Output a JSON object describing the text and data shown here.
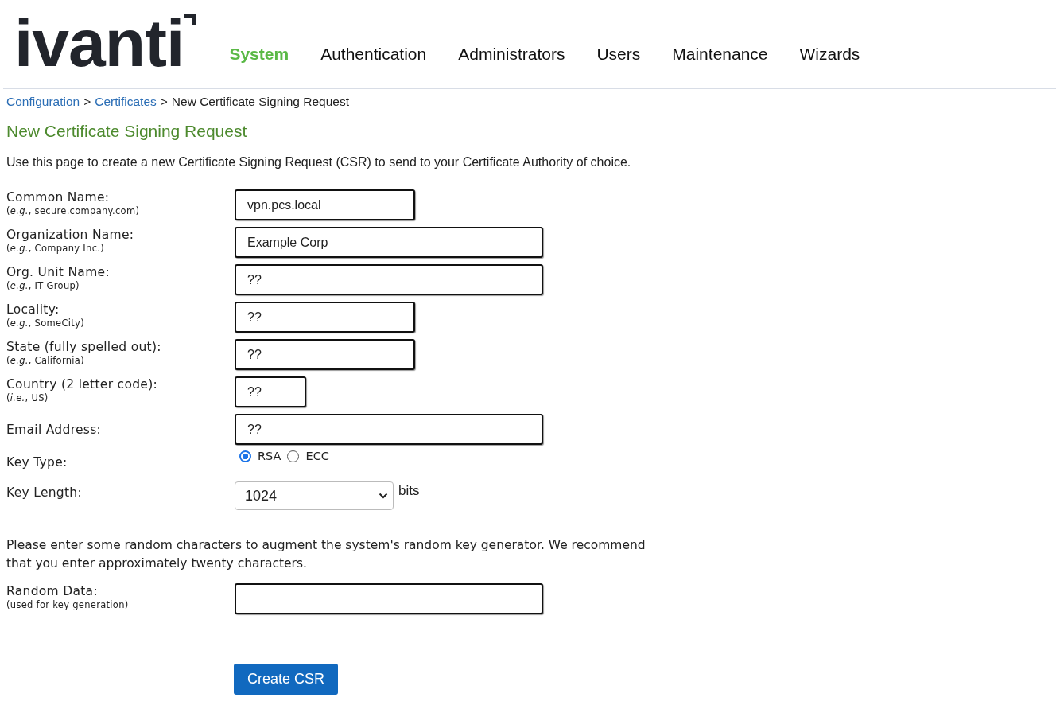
{
  "logo": {
    "text": "ivanti"
  },
  "nav": [
    {
      "label": "System",
      "selected": true
    },
    {
      "label": "Authentication",
      "selected": false
    },
    {
      "label": "Administrators",
      "selected": false
    },
    {
      "label": "Users",
      "selected": false
    },
    {
      "label": "Maintenance",
      "selected": false
    },
    {
      "label": "Wizards",
      "selected": false
    }
  ],
  "breadcrumb": [
    {
      "label": "Configuration",
      "kind": "link"
    },
    {
      "label": ">",
      "kind": "separator"
    },
    {
      "label": "Certificates",
      "kind": "link"
    },
    {
      "label": ">",
      "kind": "separator"
    },
    {
      "label": "New Certificate Signing Request",
      "kind": "current"
    }
  ],
  "page_title": "New Certificate Signing Request",
  "description": "Use this page to create a new Certificate Signing Request (CSR) to send to your Certificate Authority of choice.",
  "fields": [
    {
      "kind": "text",
      "label": "Common Name:",
      "hint": "(*e.g.*, secure.company.com)",
      "value": "vpn.pcs.local"
    },
    {
      "kind": "text",
      "label": "Organization Name:",
      "hint": "(*e.g.*, Company Inc.)",
      "value": "Example Corp"
    },
    {
      "kind": "text",
      "label": "Org. Unit Name:",
      "hint": "(*e.g.*, IT Group)",
      "value": "??"
    },
    {
      "kind": "text",
      "label": "Locality:",
      "hint": "(*e.g.*, SomeCity)",
      "value": "??"
    },
    {
      "kind": "text",
      "label": "State (fully spelled out):",
      "hint": "(*e.g.*, California)",
      "value": "??"
    },
    {
      "kind": "text",
      "label": "Country (2 letter code):",
      "hint": "(*i.e.*, US)",
      "value": "??"
    },
    {
      "kind": "text",
      "label": "Email Address:",
      "value": "??"
    },
    {
      "kind": "radio",
      "label": "Key Type:",
      "options": [
        {
          "label": "RSA",
          "selected": true
        },
        {
          "label": "ECC",
          "selected": false
        }
      ]
    },
    {
      "kind": "select",
      "label": "Key Length:",
      "value": "1024",
      "unit": "bits"
    }
  ],
  "random_note": "Please enter some random characters to augment the system's random key generator. We recommend that you enter approximately twenty characters.",
  "random_field": {
    "label": "Random Data:",
    "hint": "(used for key generation)"
  },
  "submit": {
    "label": "Create CSR"
  }
}
